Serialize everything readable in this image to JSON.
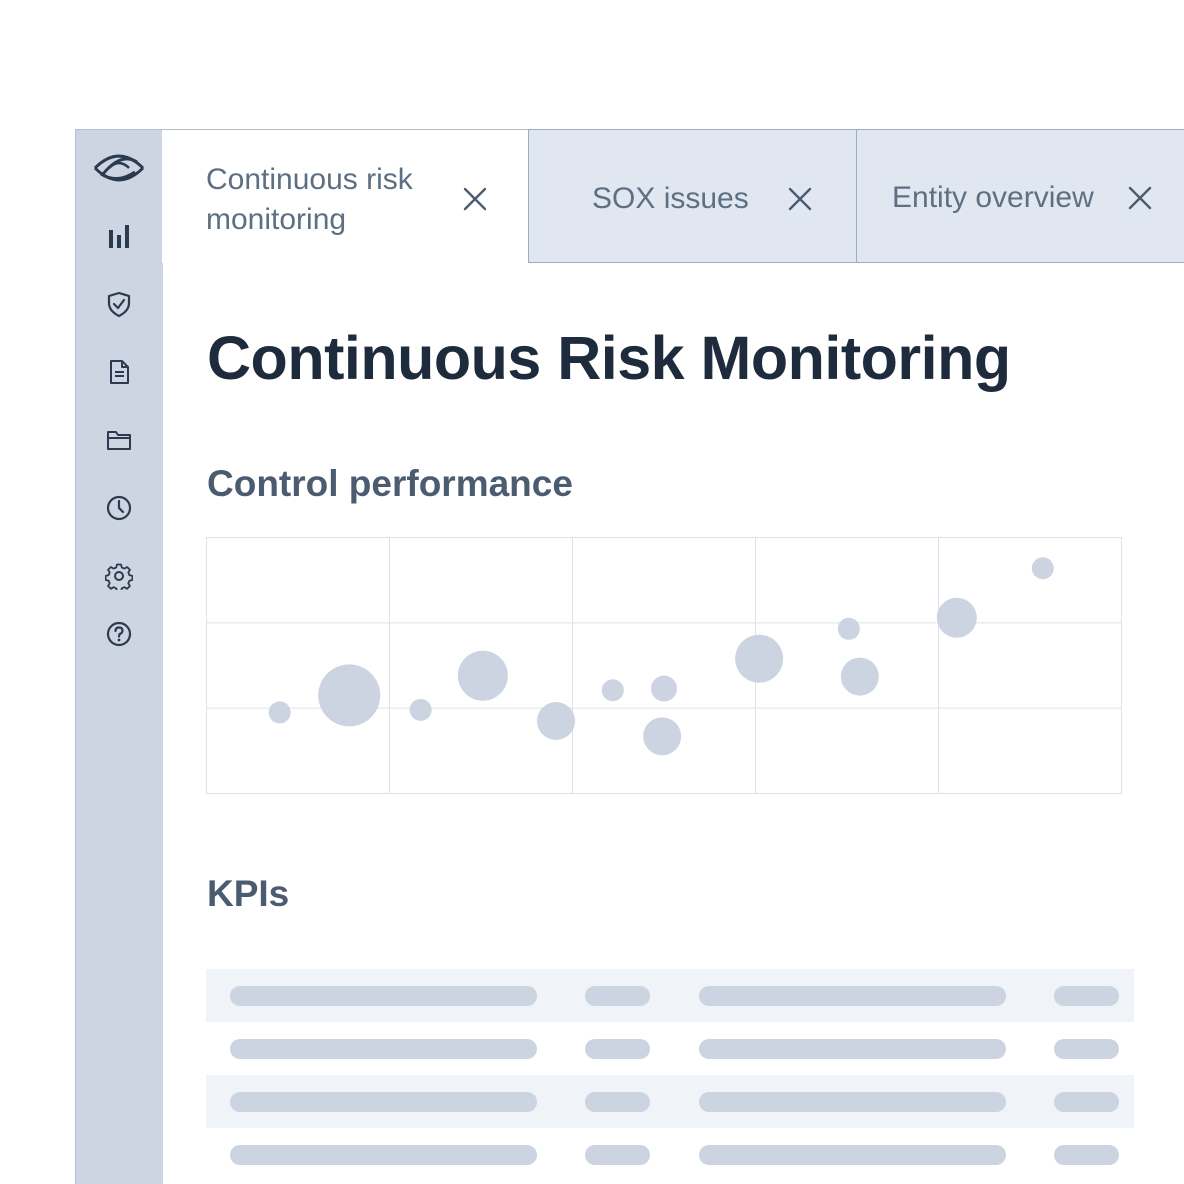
{
  "sidebar": {
    "items": [
      {
        "name": "logo-icon"
      },
      {
        "name": "bar-chart-icon"
      },
      {
        "name": "shield-check-icon"
      },
      {
        "name": "document-icon"
      },
      {
        "name": "folder-icon"
      },
      {
        "name": "clock-icon"
      },
      {
        "name": "gear-icon"
      },
      {
        "name": "help-icon"
      }
    ]
  },
  "tabs": [
    {
      "label": "Continuous risk monitoring",
      "active": true
    },
    {
      "label": "SOX issues",
      "active": false
    },
    {
      "label": "Entity overview",
      "active": false
    }
  ],
  "page": {
    "title": "Continuous Risk Monitoring",
    "sections": {
      "control_performance": "Control performance",
      "kpis": "KPIs"
    }
  },
  "colors": {
    "sidebar_bg": "#ccd5e1",
    "tab_inactive_bg": "#e1e7f0",
    "bubble": "#cbd4e0",
    "title": "#1e2b3c"
  },
  "chart_data": {
    "type": "scatter",
    "title": "",
    "xlabel": "",
    "ylabel": "",
    "xlim": [
      0,
      5
    ],
    "ylim": [
      0,
      3
    ],
    "grid": true,
    "points": [
      {
        "x": 0.4,
        "y": 0.95,
        "r": 11
      },
      {
        "x": 0.78,
        "y": 1.15,
        "r": 31
      },
      {
        "x": 1.17,
        "y": 0.98,
        "r": 11
      },
      {
        "x": 1.51,
        "y": 1.38,
        "r": 25
      },
      {
        "x": 1.91,
        "y": 0.85,
        "r": 19
      },
      {
        "x": 2.22,
        "y": 1.21,
        "r": 11
      },
      {
        "x": 2.5,
        "y": 1.23,
        "r": 13
      },
      {
        "x": 2.49,
        "y": 0.67,
        "r": 19
      },
      {
        "x": 3.02,
        "y": 1.58,
        "r": 24
      },
      {
        "x": 3.51,
        "y": 1.93,
        "r": 11
      },
      {
        "x": 3.57,
        "y": 1.37,
        "r": 19
      },
      {
        "x": 4.1,
        "y": 2.06,
        "r": 20
      },
      {
        "x": 4.57,
        "y": 2.64,
        "r": 11
      }
    ]
  },
  "kpi_table": {
    "rows": [
      {
        "shaded": true
      },
      {
        "shaded": false
      },
      {
        "shaded": true
      },
      {
        "shaded": false
      }
    ]
  }
}
